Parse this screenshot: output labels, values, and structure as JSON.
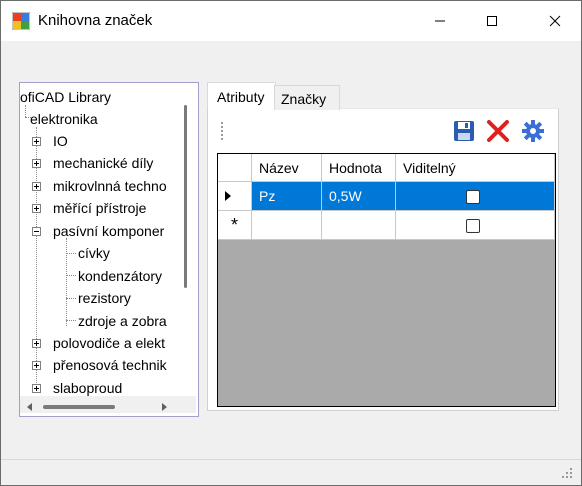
{
  "window": {
    "title": "Knihovna značek",
    "controls": [
      "minimize-icon",
      "maximize-icon",
      "close-icon"
    ]
  },
  "tree": {
    "root": "ofiCAD Library",
    "items": [
      {
        "label": "elektronika",
        "level": 0,
        "expander": "none"
      },
      {
        "label": "IO",
        "level": 1,
        "expander": "plus"
      },
      {
        "label": "mechanické díly",
        "level": 1,
        "expander": "plus"
      },
      {
        "label": "mikrovlnná techno",
        "level": 1,
        "expander": "plus"
      },
      {
        "label": "měřící přístroje",
        "level": 1,
        "expander": "plus"
      },
      {
        "label": "pasívní komponer",
        "level": 1,
        "expander": "minus"
      },
      {
        "label": "cívky",
        "level": 2,
        "expander": "none"
      },
      {
        "label": "kondenzátory",
        "level": 2,
        "expander": "none"
      },
      {
        "label": "rezistory",
        "level": 2,
        "expander": "none"
      },
      {
        "label": "zdroje a zobra",
        "level": 2,
        "expander": "none"
      },
      {
        "label": "polovodiče a elekt",
        "level": 1,
        "expander": "plus"
      },
      {
        "label": "přenosová technik",
        "level": 1,
        "expander": "plus"
      },
      {
        "label": "slaboproud",
        "level": 1,
        "expander": "plus"
      }
    ]
  },
  "tabs": [
    {
      "label": "Atributy",
      "active": true
    },
    {
      "label": "Značky",
      "active": false
    }
  ],
  "toolbar": {
    "buttons": [
      "save-icon",
      "delete-icon",
      "settings-icon"
    ]
  },
  "grid": {
    "columns": [
      "Název",
      "Hodnota",
      "Viditelný"
    ],
    "rows": [
      {
        "indicator": "current-row",
        "name": "Pz",
        "value": "0,5W",
        "visible": false,
        "selected": true
      },
      {
        "indicator": "new-row",
        "name": "",
        "value": "",
        "visible": false,
        "selected": false
      }
    ],
    "new_row_marker": "*"
  },
  "colors": {
    "selection": "#0078d7",
    "grid_background": "#aaaaaa",
    "delete_red": "#e02020",
    "save_blue": "#2a5db0",
    "settings_blue": "#3a6fd8"
  }
}
